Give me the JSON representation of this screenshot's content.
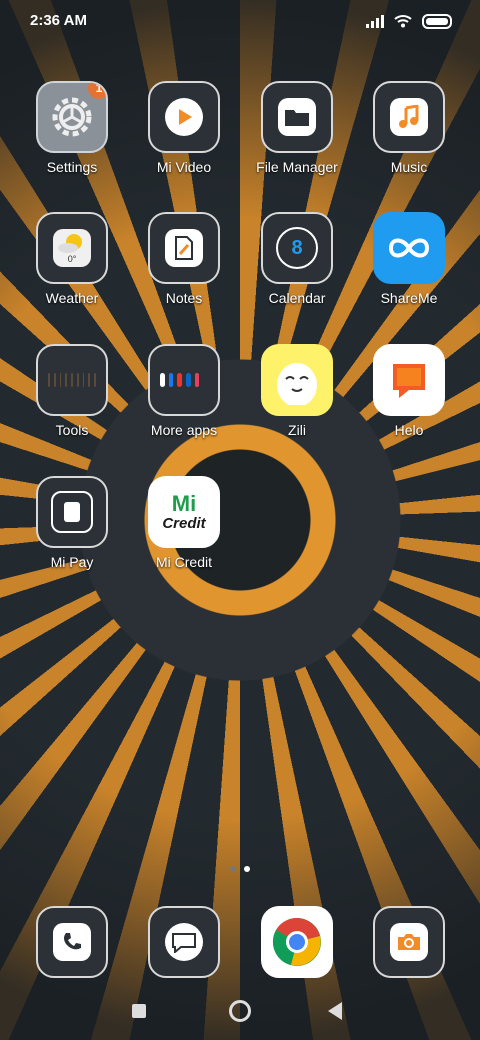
{
  "status_bar": {
    "time": "2:36 AM"
  },
  "apps": [
    {
      "id": "settings",
      "label": "Settings",
      "badge": "1"
    },
    {
      "id": "mi-video",
      "label": "Mi Video"
    },
    {
      "id": "file-manager",
      "label": "File Manager"
    },
    {
      "id": "music",
      "label": "Music"
    },
    {
      "id": "weather",
      "label": "Weather",
      "temp": "0°"
    },
    {
      "id": "notes",
      "label": "Notes"
    },
    {
      "id": "calendar",
      "label": "Calendar",
      "day": "8"
    },
    {
      "id": "shareme",
      "label": "ShareMe"
    },
    {
      "id": "tools",
      "label": "Tools"
    },
    {
      "id": "more-apps",
      "label": "More apps"
    },
    {
      "id": "zili",
      "label": "Zili"
    },
    {
      "id": "helo",
      "label": "Helo"
    },
    {
      "id": "mi-pay",
      "label": "Mi Pay"
    },
    {
      "id": "mi-credit",
      "label": "Mi Credit",
      "logo_top": "Mi",
      "logo_bottom": "Credit"
    }
  ],
  "dock": [
    {
      "id": "phone",
      "icon": "phone-icon"
    },
    {
      "id": "messages",
      "icon": "message-icon"
    },
    {
      "id": "chrome",
      "icon": "chrome-icon"
    },
    {
      "id": "camera",
      "icon": "camera-icon"
    }
  ],
  "page_indicator": {
    "pages": 2,
    "active": 1
  },
  "colors": {
    "accent": "#e37235",
    "ornament": "#d08a2b",
    "shareme": "#1f9cf0",
    "zili": "#fff26b",
    "chrome_green": "#1e9e4a"
  }
}
